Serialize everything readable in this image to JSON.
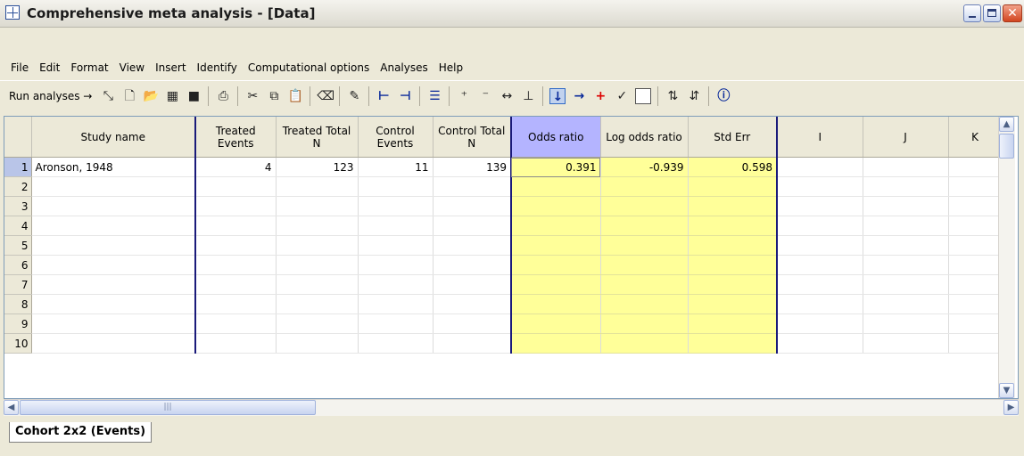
{
  "window": {
    "title": "Comprehensive meta analysis - [Data]"
  },
  "menu": [
    "File",
    "Edit",
    "Format",
    "View",
    "Insert",
    "Identify",
    "Computational options",
    "Analyses",
    "Help"
  ],
  "toolbar": {
    "run_label": "Run analyses",
    "run_arrow": "→"
  },
  "grid": {
    "columns": [
      "Study name",
      "Treated Events",
      "Treated Total N",
      "Control Events",
      "Control Total N",
      "Odds ratio",
      "Log odds ratio",
      "Std Err",
      "I",
      "J",
      "K"
    ],
    "rows": [
      {
        "num": "1",
        "cells": [
          "Aronson, 1948",
          "4",
          "123",
          "11",
          "139",
          "0.391",
          "-0.939",
          "0.598",
          "",
          "",
          ""
        ]
      },
      {
        "num": "2",
        "cells": [
          "",
          "",
          "",
          "",
          "",
          "",
          "",
          "",
          "",
          "",
          ""
        ]
      },
      {
        "num": "3",
        "cells": [
          "",
          "",
          "",
          "",
          "",
          "",
          "",
          "",
          "",
          "",
          ""
        ]
      },
      {
        "num": "4",
        "cells": [
          "",
          "",
          "",
          "",
          "",
          "",
          "",
          "",
          "",
          "",
          ""
        ]
      },
      {
        "num": "5",
        "cells": [
          "",
          "",
          "",
          "",
          "",
          "",
          "",
          "",
          "",
          "",
          ""
        ]
      },
      {
        "num": "6",
        "cells": [
          "",
          "",
          "",
          "",
          "",
          "",
          "",
          "",
          "",
          "",
          ""
        ]
      },
      {
        "num": "7",
        "cells": [
          "",
          "",
          "",
          "",
          "",
          "",
          "",
          "",
          "",
          "",
          ""
        ]
      },
      {
        "num": "8",
        "cells": [
          "",
          "",
          "",
          "",
          "",
          "",
          "",
          "",
          "",
          "",
          ""
        ]
      },
      {
        "num": "9",
        "cells": [
          "",
          "",
          "",
          "",
          "",
          "",
          "",
          "",
          "",
          "",
          ""
        ]
      },
      {
        "num": "10",
        "cells": [
          "",
          "",
          "",
          "",
          "",
          "",
          "",
          "",
          "",
          "",
          ""
        ]
      }
    ]
  },
  "sheet_tab": {
    "label": "Cohort 2x2 (Events)"
  },
  "colors": {
    "computed_cell": "#ffff99",
    "selected_header": "#b4b4ff",
    "divider": "#1a1a7a"
  }
}
